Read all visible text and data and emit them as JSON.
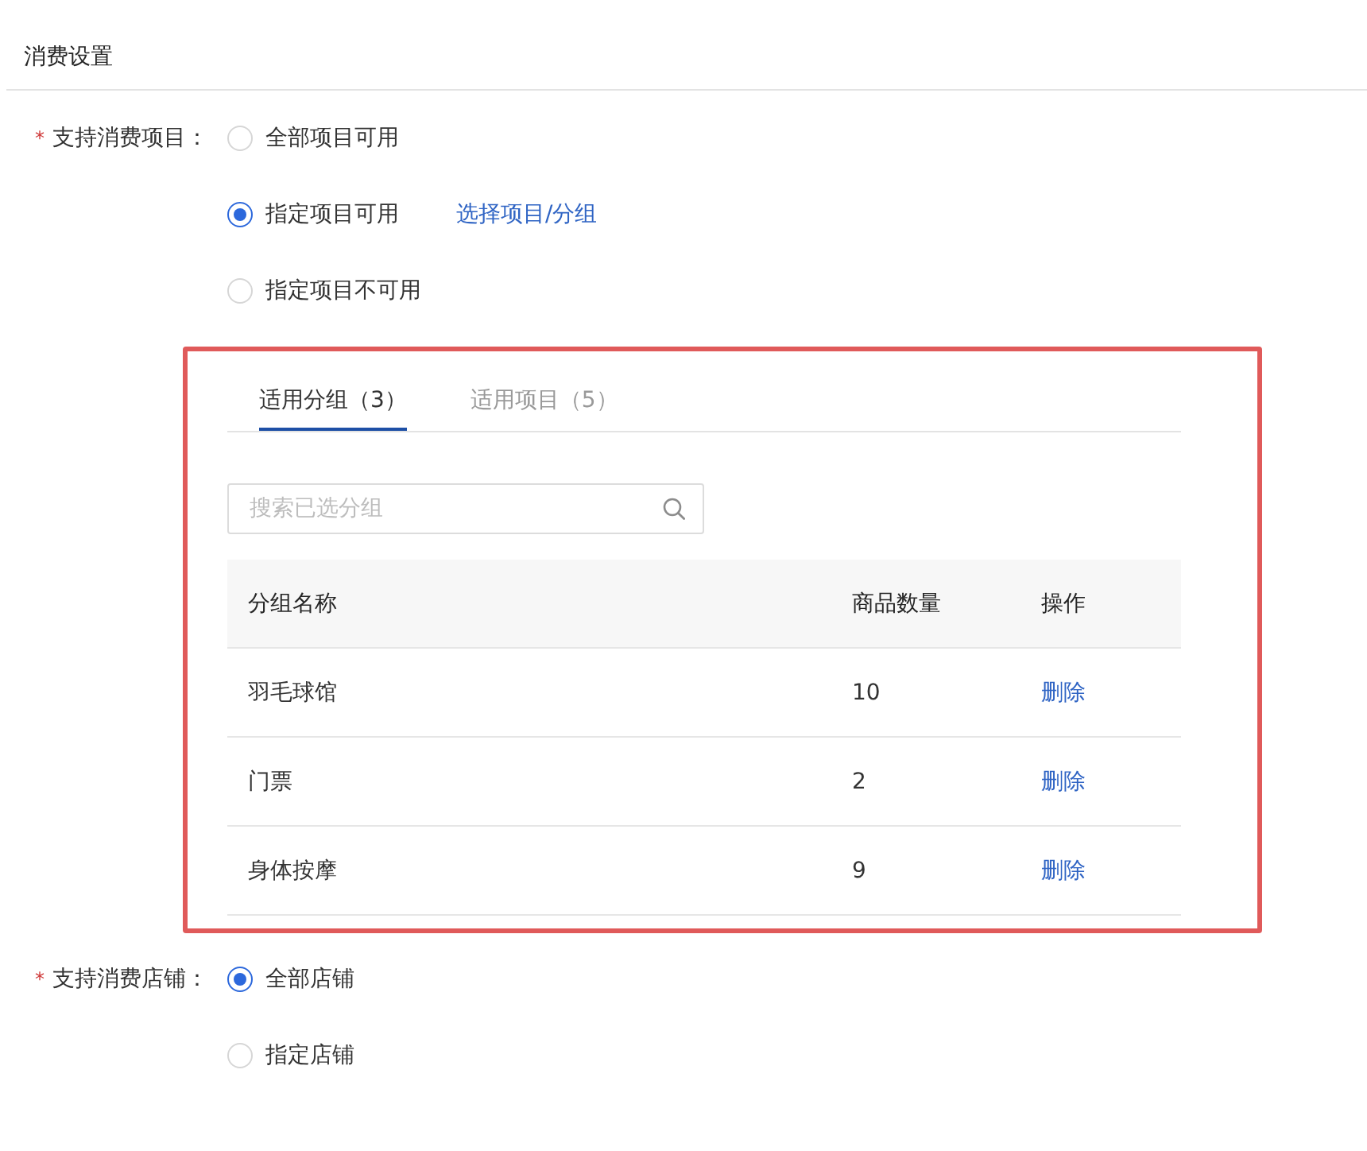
{
  "section": {
    "title": "消费设置"
  },
  "form": [
    {
      "required_mark": "*",
      "label": "支持消费项目：",
      "options": [
        {
          "label": "全部项目可用",
          "selected": false
        },
        {
          "label": "指定项目可用",
          "selected": true,
          "link": "选择项目/分组"
        },
        {
          "label": "指定项目不可用",
          "selected": false
        }
      ],
      "panel": {
        "highlighted": true,
        "tabs": [
          {
            "label": "适用分组（3）",
            "selected": true
          },
          {
            "label": "适用项目（5）",
            "selected": false
          }
        ],
        "search": {
          "placeholder": "搜索已选分组"
        },
        "table": {
          "columns": [
            "分组名称",
            "商品数量",
            "操作"
          ],
          "rows": [
            {
              "name": "羽毛球馆",
              "count": "10",
              "action": "删除"
            },
            {
              "name": "门票",
              "count": "2",
              "action": "删除"
            },
            {
              "name": "身体按摩",
              "count": "9",
              "action": "删除"
            }
          ]
        }
      }
    },
    {
      "required_mark": "*",
      "label": "支持消费店铺：",
      "options": [
        {
          "label": "全部店铺",
          "selected": true
        },
        {
          "label": "指定店铺",
          "selected": false
        }
      ]
    }
  ]
}
